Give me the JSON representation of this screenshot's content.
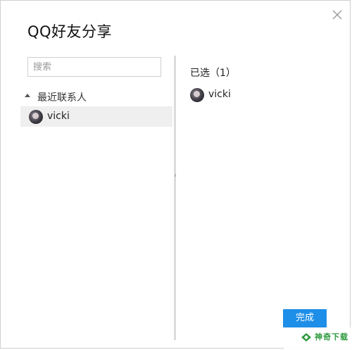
{
  "dialog": {
    "title": "QQ好友分享",
    "close_icon": "close-icon"
  },
  "left_panel": {
    "search_placeholder": "搜索",
    "group": {
      "label": "最近联系人",
      "icon": "triangle-expanded-icon",
      "contacts": [
        {
          "name": "vicki",
          "selected": true
        }
      ]
    }
  },
  "right_panel": {
    "header": "已选（1）",
    "selected": [
      {
        "name": "vicki"
      }
    ]
  },
  "actions": {
    "done_label": "完成"
  },
  "watermark": {
    "text": "神奇下载",
    "color": "#2e9a3f"
  },
  "colors": {
    "accent": "#1e8fe8",
    "row_highlight": "#efefef"
  }
}
